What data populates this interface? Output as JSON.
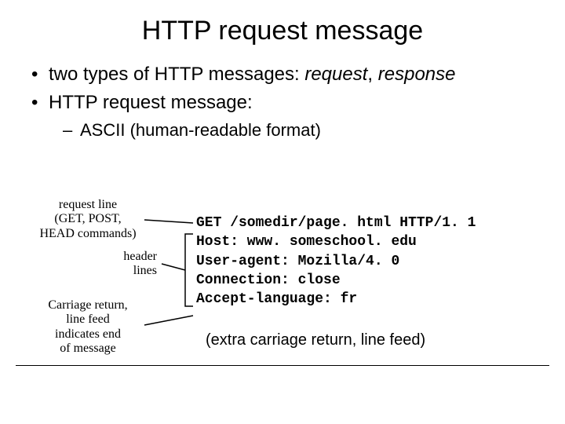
{
  "title": "HTTP request message",
  "bullets": {
    "b1_pre": "two types of HTTP messages: ",
    "b1_req": "request",
    "b1_comma": ", ",
    "b1_resp": "response",
    "b2": "HTTP request message:",
    "sub1": "ASCII (human-readable format)"
  },
  "annotations": {
    "request_line": "request line\n(GET, POST,\nHEAD commands)",
    "header_lines": "header\nlines",
    "crlf": "Carriage return,\nline feed\nindicates end\nof message"
  },
  "code": {
    "l1": "GET /somedir/page. html HTTP/1. 1",
    "l2": "Host: www. someschool. edu",
    "l3": "User-agent: Mozilla/4. 0",
    "l4": "Connection: close",
    "l5": "Accept-language: fr"
  },
  "extra": "(extra carriage return, line feed)"
}
